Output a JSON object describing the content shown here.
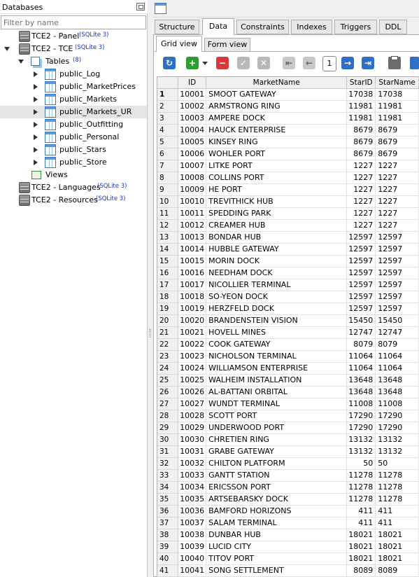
{
  "db_panel": {
    "title": "Databases",
    "filter_placeholder": "Filter by name",
    "tree": {
      "panel_db": {
        "label": "TCE2 - Panel",
        "tag": "(SQLite 3)"
      },
      "tce_db": {
        "label": "TCE2 - TCE",
        "tag": "(SQLite 3)"
      },
      "tables_folder": {
        "label": "Tables",
        "tag": "(8)"
      },
      "tables": [
        {
          "label": "public_Log"
        },
        {
          "label": "public_MarketPrices"
        },
        {
          "label": "public_Markets"
        },
        {
          "label": "public_Markets_UR",
          "selected": true
        },
        {
          "label": "public_Outfitting"
        },
        {
          "label": "public_Personal"
        },
        {
          "label": "public_Stars"
        },
        {
          "label": "public_Store"
        }
      ],
      "views_folder": {
        "label": "Views"
      },
      "languages_db": {
        "label": "TCE2 - Languages",
        "tag": "(SQLite 3)"
      },
      "resources_db": {
        "label": "TCE2 - Resources",
        "tag": "(SQLite 3)"
      }
    }
  },
  "tabs": {
    "structure": "Structure",
    "data": "Data",
    "constraints": "Constraints",
    "indexes": "Indexes",
    "triggers": "Triggers",
    "ddl": "DDL",
    "active": "Data"
  },
  "subtabs": {
    "grid_view": "Grid view",
    "form_view": "Form view",
    "active": "Grid view"
  },
  "toolbar": {
    "page": "1",
    "colors": {
      "blue": "#2f6fc6",
      "green": "#2e9e2e",
      "red": "#d83a3a",
      "grey": "#9a9a9a"
    }
  },
  "grid": {
    "columns": [
      "",
      "ID",
      "MarketName",
      "StarID",
      "StarName"
    ],
    "rows": [
      [
        "1",
        "10001",
        "SMOOT GATEWAY",
        "17038",
        "17038"
      ],
      [
        "2",
        "10002",
        "ARMSTRONG RING",
        "11981",
        "11981"
      ],
      [
        "3",
        "10003",
        "AMPERE DOCK",
        "11981",
        "11981"
      ],
      [
        "4",
        "10004",
        "HAUCK ENTERPRISE",
        "8679",
        "8679"
      ],
      [
        "5",
        "10005",
        "KINSEY RING",
        "8679",
        "8679"
      ],
      [
        "6",
        "10006",
        "WOHLER PORT",
        "8679",
        "8679"
      ],
      [
        "7",
        "10007",
        "LITKE PORT",
        "1227",
        "1227"
      ],
      [
        "8",
        "10008",
        "COLLINS PORT",
        "1227",
        "1227"
      ],
      [
        "9",
        "10009",
        "HE PORT",
        "1227",
        "1227"
      ],
      [
        "10",
        "10010",
        "TREVITHICK HUB",
        "1227",
        "1227"
      ],
      [
        "11",
        "10011",
        "SPEDDING PARK",
        "1227",
        "1227"
      ],
      [
        "12",
        "10012",
        "CREAMER HUB",
        "1227",
        "1227"
      ],
      [
        "13",
        "10013",
        "BONDAR HUB",
        "12597",
        "12597"
      ],
      [
        "14",
        "10014",
        "HUBBLE GATEWAY",
        "12597",
        "12597"
      ],
      [
        "15",
        "10015",
        "MORIN DOCK",
        "12597",
        "12597"
      ],
      [
        "16",
        "10016",
        "NEEDHAM DOCK",
        "12597",
        "12597"
      ],
      [
        "17",
        "10017",
        "NICOLLIER TERMINAL",
        "12597",
        "12597"
      ],
      [
        "18",
        "10018",
        "SO-YEON DOCK",
        "12597",
        "12597"
      ],
      [
        "19",
        "10019",
        "HERZFELD DOCK",
        "12597",
        "12597"
      ],
      [
        "20",
        "10020",
        "BRANDENSTEIN VISION",
        "15450",
        "15450"
      ],
      [
        "21",
        "10021",
        "HOVELL MINES",
        "12747",
        "12747"
      ],
      [
        "22",
        "10022",
        "COOK GATEWAY",
        "8079",
        "8079"
      ],
      [
        "23",
        "10023",
        "NICHOLSON TERMINAL",
        "11064",
        "11064"
      ],
      [
        "24",
        "10024",
        "WILLIAMSON ENTERPRISE",
        "11064",
        "11064"
      ],
      [
        "25",
        "10025",
        "WALHEIM INSTALLATION",
        "13648",
        "13648"
      ],
      [
        "26",
        "10026",
        "AL-BATTANI ORBITAL",
        "13648",
        "13648"
      ],
      [
        "27",
        "10027",
        "WUNDT TERMINAL",
        "11008",
        "11008"
      ],
      [
        "28",
        "10028",
        "SCOTT PORT",
        "17290",
        "17290"
      ],
      [
        "29",
        "10029",
        "UNDERWOOD PORT",
        "17290",
        "17290"
      ],
      [
        "30",
        "10030",
        "CHRETIEN RING",
        "13132",
        "13132"
      ],
      [
        "31",
        "10031",
        "GRABE GATEWAY",
        "13132",
        "13132"
      ],
      [
        "32",
        "10032",
        "CHILTON PLATFORM",
        "50",
        "50"
      ],
      [
        "33",
        "10033",
        "GANTT STATION",
        "11278",
        "11278"
      ],
      [
        "34",
        "10034",
        "ERICSSON PORT",
        "11278",
        "11278"
      ],
      [
        "35",
        "10035",
        "ARTSEBARSKY DOCK",
        "11278",
        "11278"
      ],
      [
        "36",
        "10036",
        "BAMFORD HORIZONS",
        "411",
        "411"
      ],
      [
        "37",
        "10037",
        "SALAM TERMINAL",
        "411",
        "411"
      ],
      [
        "38",
        "10038",
        "DUNBAR HUB",
        "18021",
        "18021"
      ],
      [
        "39",
        "10039",
        "LUCID CITY",
        "18021",
        "18021"
      ],
      [
        "40",
        "10040",
        "TITOV PORT",
        "18021",
        "18021"
      ],
      [
        "41",
        "10041",
        "SONG SETTLEMENT",
        "8089",
        "8089"
      ]
    ]
  }
}
